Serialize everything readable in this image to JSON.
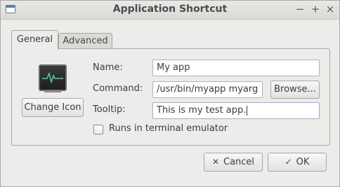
{
  "window": {
    "title": "Application Shortcut",
    "icon": "window-icon",
    "controls": {
      "minimize": "−",
      "maximize": "+",
      "close": "×"
    }
  },
  "tabs": [
    {
      "label": "General",
      "active": true
    },
    {
      "label": "Advanced",
      "active": false
    }
  ],
  "general": {
    "icon": "activity-monitor-icon",
    "change_icon_label": "Change Icon",
    "name_label": "Name:",
    "name_value": "My app",
    "command_label": "Command:",
    "command_value": "/usr/bin/myapp myarg",
    "browse_label": "Browse...",
    "tooltip_label": "Tooltip:",
    "tooltip_value": "This is my test app.",
    "terminal_label": "Runs in terminal emulator",
    "terminal_checked": false
  },
  "footer": {
    "cancel_label": "Cancel",
    "cancel_icon": "x-icon",
    "ok_label": "OK",
    "ok_icon": "checkmark-icon"
  }
}
